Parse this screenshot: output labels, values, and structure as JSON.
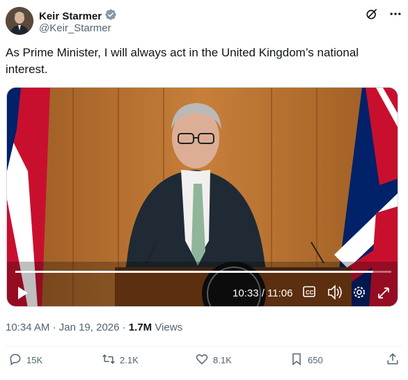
{
  "author": {
    "name": "Keir Starmer",
    "handle": "@Keir_Starmer",
    "verified_icon": "verified-badge-icon"
  },
  "top_actions": [
    "grok-icon",
    "more-icon"
  ],
  "tweet": {
    "text": "As Prime Minister, I will always act in the United Kingdom’s national interest."
  },
  "video": {
    "current_time": "10:33 / 11:06",
    "progress_fraction": 0.951,
    "controls": [
      "play-icon",
      "captions-icon",
      "volume-icon",
      "settings-icon",
      "fullscreen-icon"
    ],
    "captions_label": "CC"
  },
  "meta": {
    "time": "10:34 AM",
    "sep1": "·",
    "date": "Jan 19, 2026",
    "sep2": "·",
    "views_count": "1.7M",
    "views_label": "Views"
  },
  "actions": {
    "replies": "15K",
    "reposts": "2.1K",
    "likes": "8.1K",
    "bookmarks": "650"
  },
  "colors": {
    "text": "#0f1419",
    "secondary": "#536471",
    "verified": "#829aab",
    "divider": "#eff3f4"
  }
}
